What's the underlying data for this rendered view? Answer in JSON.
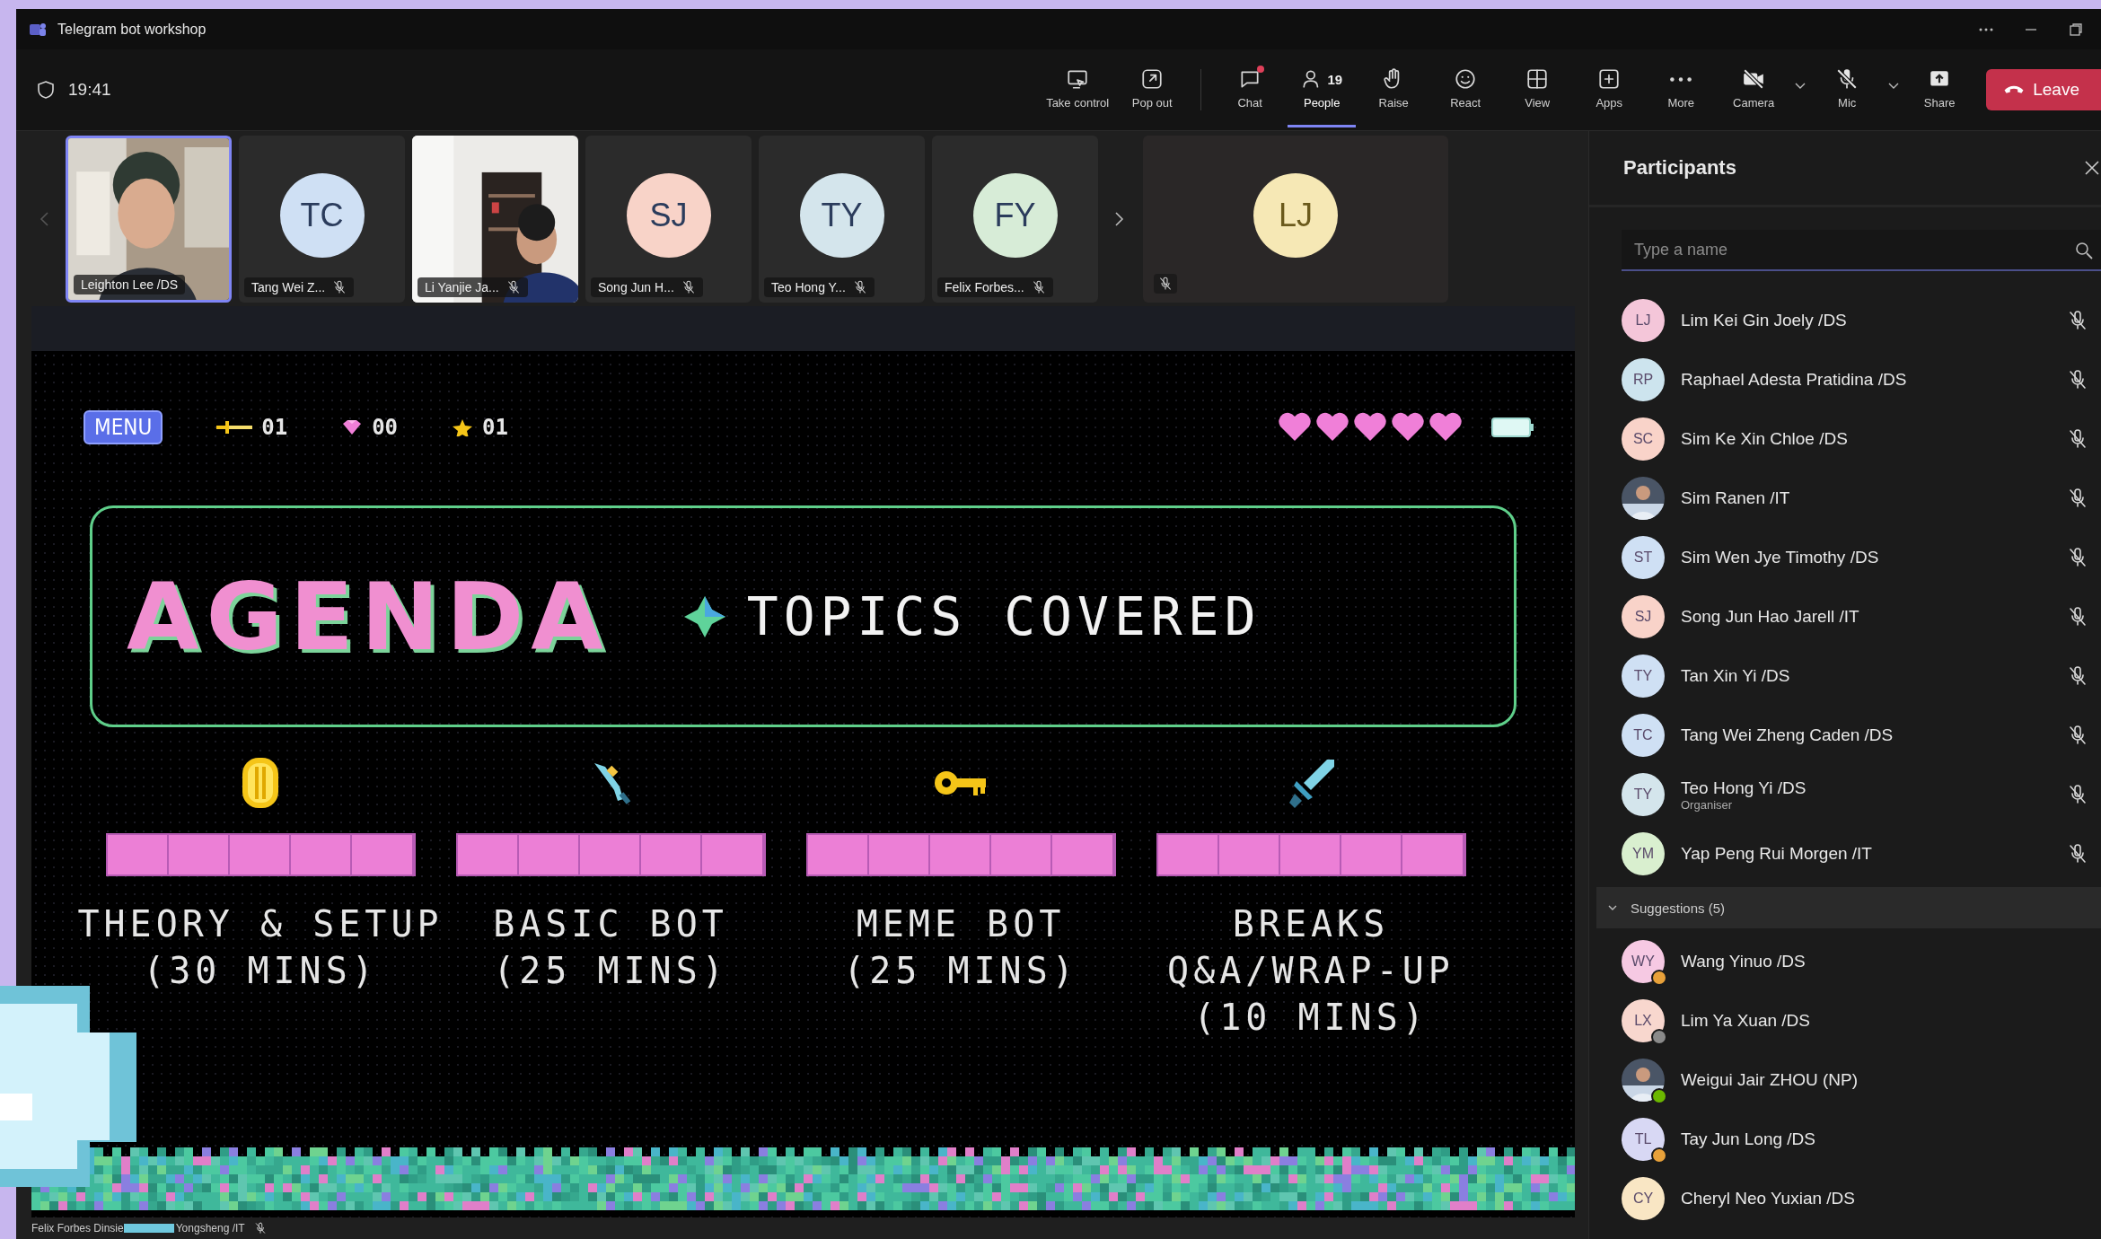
{
  "window": {
    "title": "Telegram bot workshop"
  },
  "meeting": {
    "time": "19:41"
  },
  "toolbar": [
    {
      "kind": "take-control",
      "label": "Take control",
      "selected": false,
      "notification": false,
      "off": false,
      "dropdown": false
    },
    {
      "kind": "pop-out",
      "label": "Pop out",
      "selected": false,
      "notification": false,
      "off": false,
      "dropdown": false
    },
    {
      "kind": "chat",
      "label": "Chat",
      "selected": false,
      "notification": true,
      "off": false,
      "dropdown": false
    },
    {
      "kind": "people",
      "label": "People",
      "count": "19",
      "selected": true,
      "notification": false,
      "off": false,
      "dropdown": false
    },
    {
      "kind": "raise",
      "label": "Raise",
      "selected": false,
      "notification": false,
      "off": false,
      "dropdown": false
    },
    {
      "kind": "react",
      "label": "React",
      "selected": false,
      "notification": false,
      "off": false,
      "dropdown": false
    },
    {
      "kind": "view",
      "label": "View",
      "selected": false,
      "notification": false,
      "off": false,
      "dropdown": false
    },
    {
      "kind": "apps",
      "label": "Apps",
      "selected": false,
      "notification": false,
      "off": false,
      "dropdown": false
    },
    {
      "kind": "more",
      "label": "More",
      "selected": false,
      "notification": false,
      "off": false,
      "dropdown": false
    },
    {
      "kind": "camera",
      "label": "Camera",
      "selected": false,
      "notification": false,
      "off": true,
      "dropdown": true
    },
    {
      "kind": "mic",
      "label": "Mic",
      "selected": false,
      "notification": false,
      "off": true,
      "dropdown": true
    },
    {
      "kind": "share",
      "label": "Share",
      "selected": false,
      "notification": false,
      "off": false,
      "dropdown": false
    }
  ],
  "leave_button": {
    "label": "Leave"
  },
  "video_strip": {
    "tiles": [
      {
        "kind": "video",
        "name": "Leighton Lee /DS",
        "muted": false,
        "selected": true
      },
      {
        "kind": "avatar",
        "initials": "TC",
        "color": "#cfe0f4",
        "name": "Tang Wei Z...",
        "muted": true,
        "selected": false
      },
      {
        "kind": "video",
        "name": "Li Yanjie Ja...",
        "muted": true,
        "selected": false
      },
      {
        "kind": "avatar",
        "initials": "SJ",
        "color": "#f8d3c8",
        "name": "Song Jun H...",
        "muted": true,
        "selected": false
      },
      {
        "kind": "avatar",
        "initials": "TY",
        "color": "#d4e5ec",
        "name": "Teo Hong Y...",
        "muted": true,
        "selected": false
      },
      {
        "kind": "avatar",
        "initials": "FY",
        "color": "#d7ecd7",
        "name": "Felix Forbes...",
        "muted": true,
        "selected": false
      }
    ],
    "pinned_tile": {
      "initials": "LJ",
      "color": "#f6e8b5",
      "muted": true
    }
  },
  "slide": {
    "menu_label": "MENU",
    "counters": [
      {
        "kind": "sword",
        "value": "01"
      },
      {
        "kind": "gem",
        "value": "00"
      },
      {
        "kind": "star",
        "value": "01"
      }
    ],
    "title": "AGENDA",
    "subtitle": "TOPICS COVERED",
    "topics": [
      {
        "kind": "coin",
        "lines": [
          "THEORY & SETUP",
          "(30 MINS)"
        ]
      },
      {
        "kind": "pickaxe",
        "lines": [
          "BASIC BOT",
          "(25 MINS)"
        ]
      },
      {
        "kind": "key",
        "lines": [
          "MEME BOT",
          "(25 MINS)"
        ]
      },
      {
        "kind": "sword",
        "lines": [
          "BREAKS",
          "Q&A/WRAP-UP",
          "(10 MINS)"
        ]
      }
    ]
  },
  "presenter_caption": {
    "name_start": "Felix Forbes Dinsie",
    "name_end": "Yongsheng /IT",
    "muted": true
  },
  "participants": {
    "title": "Participants",
    "search": {
      "placeholder": "Type a name"
    },
    "in_meeting": [
      {
        "kind": "initials",
        "initials": "LJ",
        "color": "#f4c6d9",
        "name": "Lim Kei Gin Joely /DS",
        "muted": true
      },
      {
        "kind": "initials",
        "initials": "RP",
        "color": "#cde4ee",
        "name": "Raphael Adesta Pratidina /DS",
        "muted": true
      },
      {
        "kind": "initials",
        "initials": "SC",
        "color": "#f9d3c9",
        "name": "Sim Ke Xin Chloe /DS",
        "muted": true
      },
      {
        "name": "Sim Ranen /IT",
        "muted": true
      },
      {
        "kind": "initials",
        "initials": "ST",
        "color": "#cfe0f4",
        "name": "Sim Wen Jye Timothy /DS",
        "muted": true
      },
      {
        "kind": "initials",
        "initials": "SJ",
        "color": "#f9d3c9",
        "name": "Song Jun Hao Jarell /IT",
        "muted": true
      },
      {
        "kind": "initials",
        "initials": "TY",
        "color": "#cfe0f4",
        "name": "Tan Xin Yi /DS",
        "muted": true
      },
      {
        "kind": "initials",
        "initials": "TC",
        "color": "#cfe0f4",
        "name": "Tang Wei Zheng Caden /DS",
        "muted": true
      },
      {
        "kind": "initials",
        "initials": "TY",
        "color": "#d4e5ec",
        "name": "Teo Hong Yi /DS",
        "role": "Organiser",
        "muted": true
      },
      {
        "kind": "initials",
        "initials": "YM",
        "color": "#d9efcf",
        "name": "Yap Peng Rui Morgen /IT",
        "muted": true
      }
    ],
    "suggestions": {
      "label": "Suggestions (5)",
      "expanded": true,
      "people": [
        {
          "kind": "initials",
          "initials": "WY",
          "color": "#f6c9e3",
          "name": "Wang Yinuo /DS",
          "status": {
            "color": "#e8a13a"
          }
        },
        {
          "kind": "initials",
          "initials": "LX",
          "color": "#f8d7ce",
          "name": "Lim Ya Xuan /DS",
          "status": {
            "color": "#8a8a8a"
          }
        },
        {
          "name": "Weigui Jair ZHOU (NP)",
          "status": {
            "color": "#6bb700"
          }
        },
        {
          "kind": "initials",
          "initials": "TL",
          "color": "#d8d8f4",
          "name": "Tay Jun Long /DS",
          "status": {
            "color": "#e8a13a"
          }
        },
        {
          "kind": "initials",
          "initials": "CY",
          "color": "#f9e6c4",
          "name": "Cheryl Neo Yuxian /DS"
        }
      ]
    }
  }
}
